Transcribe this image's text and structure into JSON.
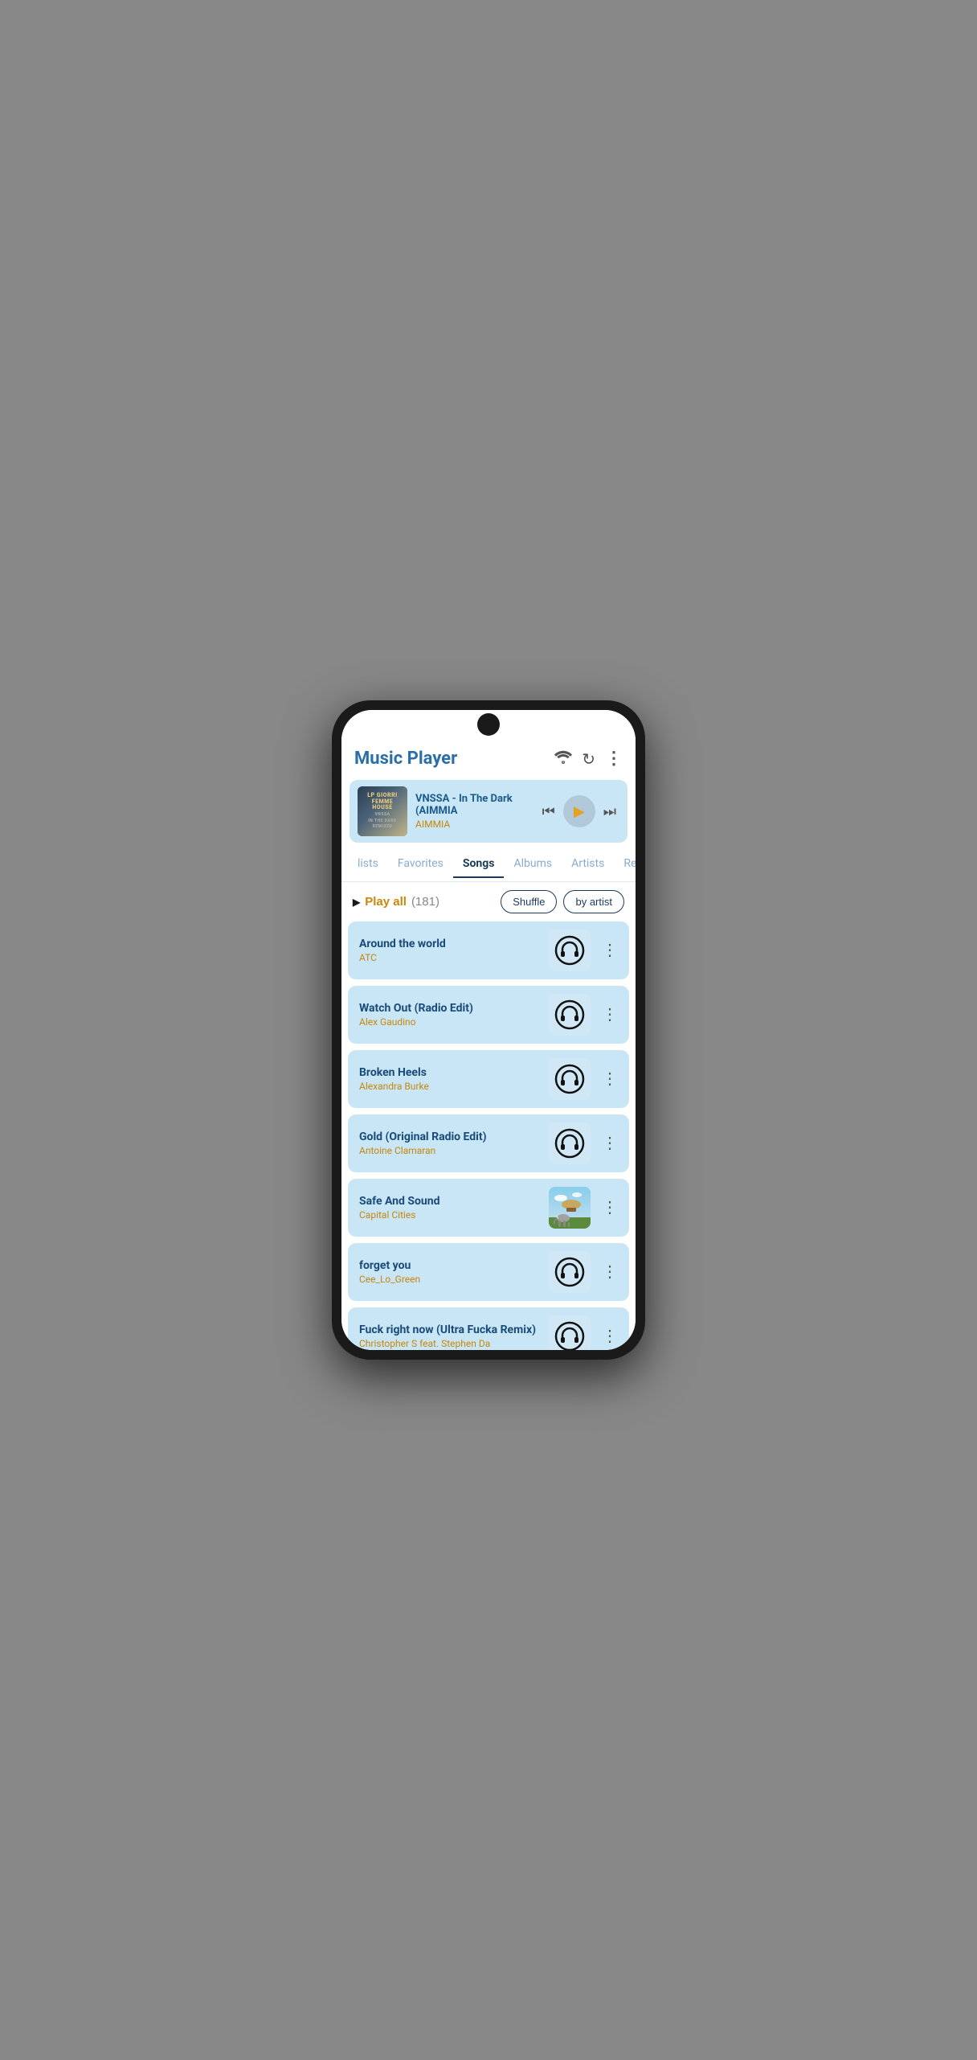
{
  "app": {
    "title": "Music Player"
  },
  "now_playing": {
    "title": "VNSSA - In The Dark (AIMMIA",
    "artist": "AIMMIA",
    "album_label": "LP GIORRI\nFEMME\nHOUSE\nVNSSA\nIN THE DARK\nREMIXED"
  },
  "tabs": [
    {
      "label": "lists",
      "active": false
    },
    {
      "label": "Favorites",
      "active": false
    },
    {
      "label": "Songs",
      "active": true
    },
    {
      "label": "Albums",
      "active": false
    },
    {
      "label": "Artists",
      "active": false
    },
    {
      "label": "Re...",
      "active": false
    }
  ],
  "list_controls": {
    "play_all_label": "Play all",
    "play_all_count": "(181)",
    "shuffle_label": "Shuffle",
    "by_artist_label": "by artist"
  },
  "songs": [
    {
      "title": "Around the world",
      "artist": "ATC",
      "has_album_art": false
    },
    {
      "title": "Watch Out (Radio Edit)",
      "artist": "Alex Gaudino",
      "has_album_art": false
    },
    {
      "title": "Broken Heels",
      "artist": "Alexandra Burke",
      "has_album_art": false
    },
    {
      "title": "Gold (Original Radio Edit)",
      "artist": "Antoine Clamaran",
      "has_album_art": false
    },
    {
      "title": "Safe And Sound",
      "artist": "Capital Cities",
      "has_album_art": true
    },
    {
      "title": "forget you",
      "artist": "Cee_Lo_Green",
      "has_album_art": false
    },
    {
      "title": "Fuck right now (Ultra Fucka Remix)",
      "artist": "Christopher S feat. Stephen Da",
      "has_album_art": false,
      "partial": true
    }
  ],
  "icons": {
    "wifi": "wifi",
    "refresh": "↻",
    "more_vert": "⋮",
    "rewind": "⏮",
    "play": "▶",
    "fast_forward": "⏭"
  }
}
